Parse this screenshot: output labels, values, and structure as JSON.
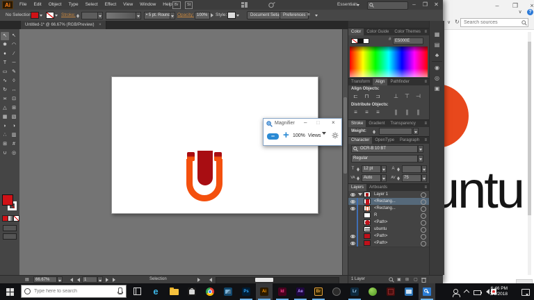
{
  "ai": {
    "logo": "Ai",
    "menus": [
      "File",
      "Edit",
      "Object",
      "Type",
      "Select",
      "Effect",
      "View",
      "Window",
      "Help"
    ],
    "bridge_button": "Br",
    "stock_button": "St",
    "workspace": "Essentials",
    "win": {
      "min": "–",
      "max": "❐",
      "close": "✕"
    },
    "control": {
      "selection": "No Selection",
      "stroke_label": "Stroke:",
      "brush": "5 pt. Round",
      "brush_dot": "•",
      "opacity_label": "Opacity:",
      "opacity": "100%",
      "style_label": "Style:",
      "doc_setup": "Document Setup",
      "preferences": "Preferences"
    },
    "tab": {
      "title": "Untitled-1* @ 66.67% (RGB/Preview)",
      "close": "×"
    },
    "status": {
      "zoom": "66.67%",
      "artboard": "1",
      "text": "Selection"
    },
    "panels": {
      "color": {
        "tabs": [
          "Color",
          "Color Guide",
          "Color Themes"
        ],
        "hex_label": "#",
        "hex": "E5000E"
      },
      "align": {
        "tabs": [
          "Transform",
          "Align",
          "Pathfinder"
        ],
        "align_objects": "Align Objects:",
        "distribute_objects": "Distribute Objects:"
      },
      "stroke": {
        "tabs": [
          "Stroke",
          "Gradient",
          "Transparency"
        ],
        "weight_label": "Weight:"
      },
      "character": {
        "tabs": [
          "Character",
          "OpenType",
          "Paragraph"
        ],
        "font": "OCR-B 10 BT",
        "style": "Regular",
        "size": "12 pt",
        "kerning": "Auto",
        "tracking": "75"
      },
      "layers": {
        "tabs": [
          "Layers",
          "Artboards"
        ],
        "rows": [
          {
            "name": "Layer 1"
          },
          {
            "name": "<Rectang..."
          },
          {
            "name": "<Rectang..."
          },
          {
            "name": "R"
          },
          {
            "name": "<Path>"
          },
          {
            "name": "ubuntu"
          },
          {
            "name": "<Path>"
          },
          {
            "name": "<Path>"
          }
        ],
        "footer": "1 Layer"
      }
    }
  },
  "icons": {
    "tools": [
      {
        "name": "selection-tool",
        "glyph": "↖"
      },
      {
        "name": "direct-selection-tool",
        "glyph": "↖"
      },
      {
        "name": "magic-wand-tool",
        "glyph": "✱"
      },
      {
        "name": "lasso-tool",
        "glyph": "◠"
      },
      {
        "name": "pen-tool",
        "glyph": "♦"
      },
      {
        "name": "curvature-tool",
        "glyph": "∕"
      },
      {
        "name": "type-tool",
        "glyph": "T"
      },
      {
        "name": "line-tool",
        "glyph": "─"
      },
      {
        "name": "rectangle-tool",
        "glyph": "▭"
      },
      {
        "name": "paintbrush-tool",
        "glyph": "✎"
      },
      {
        "name": "shaper-tool",
        "glyph": "∿"
      },
      {
        "name": "eraser-tool",
        "glyph": "◊"
      },
      {
        "name": "rotate-tool",
        "glyph": "↻"
      },
      {
        "name": "scale-tool",
        "glyph": "↔"
      },
      {
        "name": "width-tool",
        "glyph": "≍"
      },
      {
        "name": "free-transform-tool",
        "glyph": "⊡"
      },
      {
        "name": "shape-builder-tool",
        "glyph": "△"
      },
      {
        "name": "perspective-grid-tool",
        "glyph": "⊞"
      },
      {
        "name": "mesh-tool",
        "glyph": "▦"
      },
      {
        "name": "gradient-tool",
        "glyph": "▧"
      },
      {
        "name": "eyedropper-tool",
        "glyph": "◗"
      },
      {
        "name": "blend-tool",
        "glyph": "◑"
      },
      {
        "name": "symbol-sprayer-tool",
        "glyph": "∴"
      },
      {
        "name": "graph-tool",
        "glyph": "▥"
      },
      {
        "name": "artboard-tool",
        "glyph": "⊞"
      },
      {
        "name": "slice-tool",
        "glyph": "#"
      },
      {
        "name": "hand-tool",
        "glyph": "∪"
      },
      {
        "name": "zoom-tool",
        "glyph": "◎"
      }
    ],
    "align": [
      "⊏",
      "⊓",
      "⊐",
      "⊥",
      "⊤",
      "⊣"
    ],
    "distribute": [
      "≡",
      "≡",
      "≡",
      "∥",
      "∥",
      "∥"
    ],
    "dock": [
      "▦",
      "▤",
      "♣",
      "◉",
      "◎",
      "▣"
    ],
    "character": {
      "size": "T",
      "leading": "A",
      "kerning": "VA",
      "tracking": "AV"
    },
    "layers_footer": [
      "▣",
      "⊞",
      "▢"
    ],
    "export": "▤",
    "panel_menu": "≡",
    "collapse": "»"
  },
  "magnifier": {
    "title": "Magnifier",
    "minus": "−",
    "plus": "+",
    "zoom": "100%",
    "views": "Views",
    "min": "–",
    "close": "×"
  },
  "bgwin": {
    "search_placeholder": "Search sources",
    "visible_text": "ubuntu",
    "min": "–",
    "max": "❐",
    "close": "×",
    "help": "?"
  },
  "taskbar": {
    "search_placeholder": "Type here to search",
    "apps": {
      "edge": "e",
      "ps": "Ps",
      "ai": "Ai",
      "id": "Id",
      "ae": "Ae",
      "br": "Br",
      "lr": "Lr"
    },
    "time": "6:46 PM",
    "date": "3/1/2018"
  },
  "colors": {
    "fill_red": "#E5000E",
    "logo_orange": "#F4500E",
    "logo_dark_red": "#A80D12",
    "ubuntu_orange": "#E8481C",
    "taskbar_accent": "#6CB2E8"
  }
}
